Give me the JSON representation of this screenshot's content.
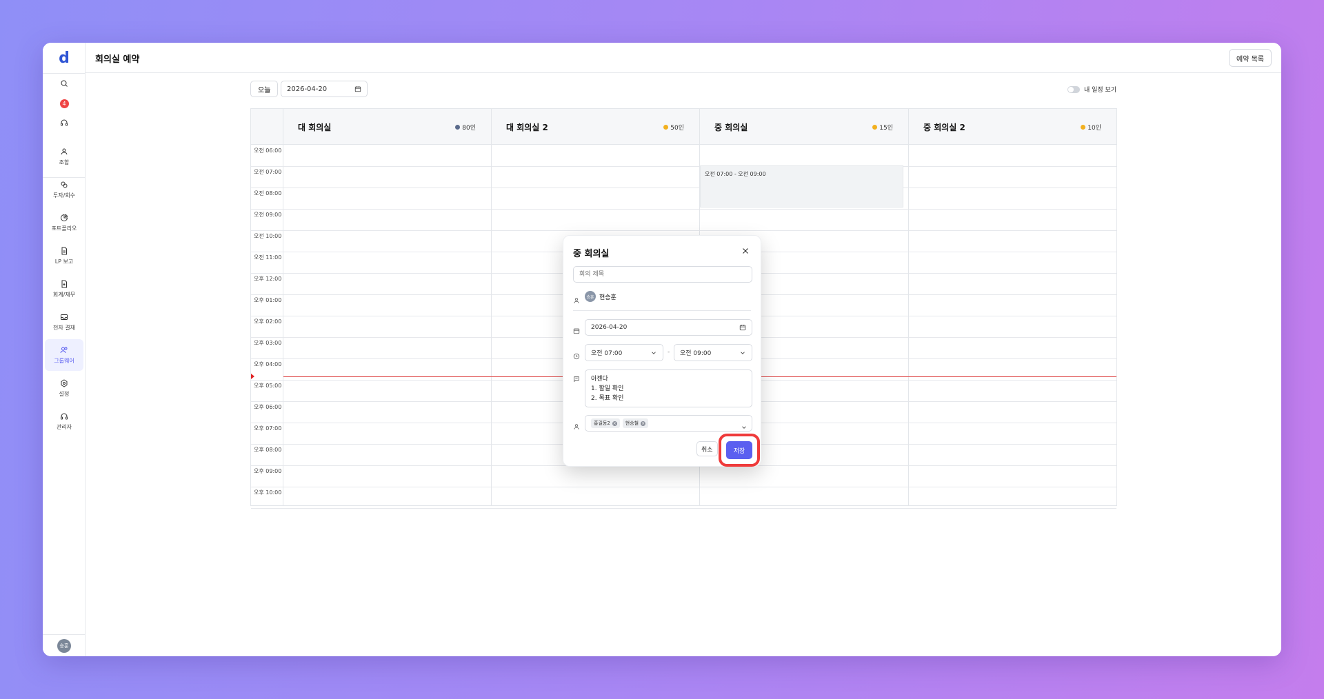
{
  "app": {
    "logo": "d",
    "page_title": "회의실 예약",
    "list_button": "예약 목록"
  },
  "sidebar": {
    "badge_count": "4",
    "items": [
      {
        "icon": "group-icon",
        "label": "조합"
      },
      {
        "icon": "invest-icon",
        "label": "투자/회수"
      },
      {
        "icon": "portfolio-icon",
        "label": "포트폴리오"
      },
      {
        "icon": "document-icon",
        "label": "LP 보고"
      },
      {
        "icon": "accounting-icon",
        "label": "회계/재무"
      },
      {
        "icon": "approval-icon",
        "label": "전자 결재"
      },
      {
        "icon": "groupware-icon",
        "label": "그룹웨어"
      },
      {
        "icon": "settings-icon",
        "label": "설정"
      },
      {
        "icon": "admin-icon",
        "label": "관리자"
      }
    ],
    "user_initials": "승훈"
  },
  "toolbar": {
    "today": "오늘",
    "date": "2026-04-20",
    "my_schedule": "내 일정 보기"
  },
  "rooms": [
    {
      "name": "대 회의실",
      "capacity": "80인",
      "color": "#5b6b8c"
    },
    {
      "name": "대 회의실 2",
      "capacity": "50인",
      "color": "#f2b01e"
    },
    {
      "name": "중 회의실",
      "capacity": "15인",
      "color": "#f2b01e"
    },
    {
      "name": "중 회의실 2",
      "capacity": "10인",
      "color": "#f2b01e"
    }
  ],
  "times": [
    "오전 06:00",
    "오전 07:00",
    "오전 08:00",
    "오전 09:00",
    "오전 10:00",
    "오전 11:00",
    "오후 12:00",
    "오후 01:00",
    "오후 02:00",
    "오후 03:00",
    "오후 04:00",
    "오후 05:00",
    "오후 06:00",
    "오후 07:00",
    "오후 08:00",
    "오후 09:00",
    "오후 10:00"
  ],
  "event": {
    "label": "오전 07:00 - 오전 09:00"
  },
  "modal": {
    "title": "중 회의실",
    "title_placeholder": "회의 제목",
    "organizer_initials": "승훈",
    "organizer_name": "현승훈",
    "date": "2026-04-20",
    "start_time": "오전 07:00",
    "end_time": "오전 09:00",
    "separator": "-",
    "agenda": "아젠다\n1. 할일 확인\n2. 목표 확인",
    "attendees": [
      "홍길동2",
      "현승철"
    ],
    "cancel": "취소",
    "save": "저장"
  }
}
